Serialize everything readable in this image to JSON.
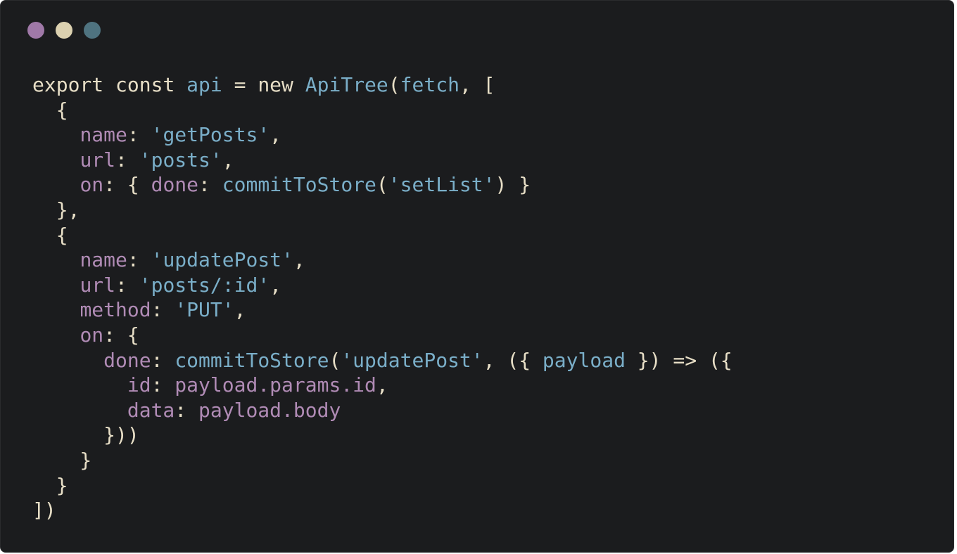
{
  "window": {
    "controls": [
      {
        "name": "close",
        "color": "#a079a8"
      },
      {
        "name": "minimize",
        "color": "#dcd1b0"
      },
      {
        "name": "maximize",
        "color": "#4f7380"
      }
    ]
  },
  "code": {
    "lines": [
      [
        [
          "kw",
          "export"
        ],
        [
          "plain",
          " "
        ],
        [
          "kw",
          "const"
        ],
        [
          "plain",
          " "
        ],
        [
          "var",
          "api"
        ],
        [
          "plain",
          " = "
        ],
        [
          "kw",
          "new"
        ],
        [
          "plain",
          " "
        ],
        [
          "fn",
          "ApiTree"
        ],
        [
          "punc",
          "("
        ],
        [
          "var",
          "fetch"
        ],
        [
          "punc",
          ", ["
        ]
      ],
      [
        [
          "plain",
          "  {"
        ]
      ],
      [
        [
          "plain",
          "    "
        ],
        [
          "prop",
          "name"
        ],
        [
          "punc",
          ": "
        ],
        [
          "str",
          "'getPosts'"
        ],
        [
          "punc",
          ","
        ]
      ],
      [
        [
          "plain",
          "    "
        ],
        [
          "prop",
          "url"
        ],
        [
          "punc",
          ": "
        ],
        [
          "str",
          "'posts'"
        ],
        [
          "punc",
          ","
        ]
      ],
      [
        [
          "plain",
          "    "
        ],
        [
          "prop",
          "on"
        ],
        [
          "punc",
          ": { "
        ],
        [
          "prop",
          "done"
        ],
        [
          "punc",
          ": "
        ],
        [
          "fn",
          "commitToStore"
        ],
        [
          "punc",
          "("
        ],
        [
          "str",
          "'setList'"
        ],
        [
          "punc",
          ") }"
        ]
      ],
      [
        [
          "plain",
          "  },"
        ]
      ],
      [
        [
          "plain",
          "  {"
        ]
      ],
      [
        [
          "plain",
          "    "
        ],
        [
          "prop",
          "name"
        ],
        [
          "punc",
          ": "
        ],
        [
          "str",
          "'updatePost'"
        ],
        [
          "punc",
          ","
        ]
      ],
      [
        [
          "plain",
          "    "
        ],
        [
          "prop",
          "url"
        ],
        [
          "punc",
          ": "
        ],
        [
          "str",
          "'posts/:id'"
        ],
        [
          "punc",
          ","
        ]
      ],
      [
        [
          "plain",
          "    "
        ],
        [
          "prop",
          "method"
        ],
        [
          "punc",
          ": "
        ],
        [
          "str",
          "'PUT'"
        ],
        [
          "punc",
          ","
        ]
      ],
      [
        [
          "plain",
          "    "
        ],
        [
          "prop",
          "on"
        ],
        [
          "punc",
          ": {"
        ]
      ],
      [
        [
          "plain",
          "      "
        ],
        [
          "prop",
          "done"
        ],
        [
          "punc",
          ": "
        ],
        [
          "fn",
          "commitToStore"
        ],
        [
          "punc",
          "("
        ],
        [
          "str",
          "'updatePost'"
        ],
        [
          "punc",
          ", ({ "
        ],
        [
          "var",
          "payload"
        ],
        [
          "punc",
          " }) => ({"
        ]
      ],
      [
        [
          "plain",
          "        "
        ],
        [
          "prop",
          "id"
        ],
        [
          "punc",
          ": "
        ],
        [
          "prop",
          "payload.params.id"
        ],
        [
          "punc",
          ","
        ]
      ],
      [
        [
          "plain",
          "        "
        ],
        [
          "prop",
          "data"
        ],
        [
          "punc",
          ": "
        ],
        [
          "prop",
          "payload.body"
        ]
      ],
      [
        [
          "plain",
          "      }))"
        ]
      ],
      [
        [
          "plain",
          "    }"
        ]
      ],
      [
        [
          "plain",
          "  }"
        ]
      ],
      [
        [
          "plain",
          "])"
        ]
      ]
    ]
  }
}
